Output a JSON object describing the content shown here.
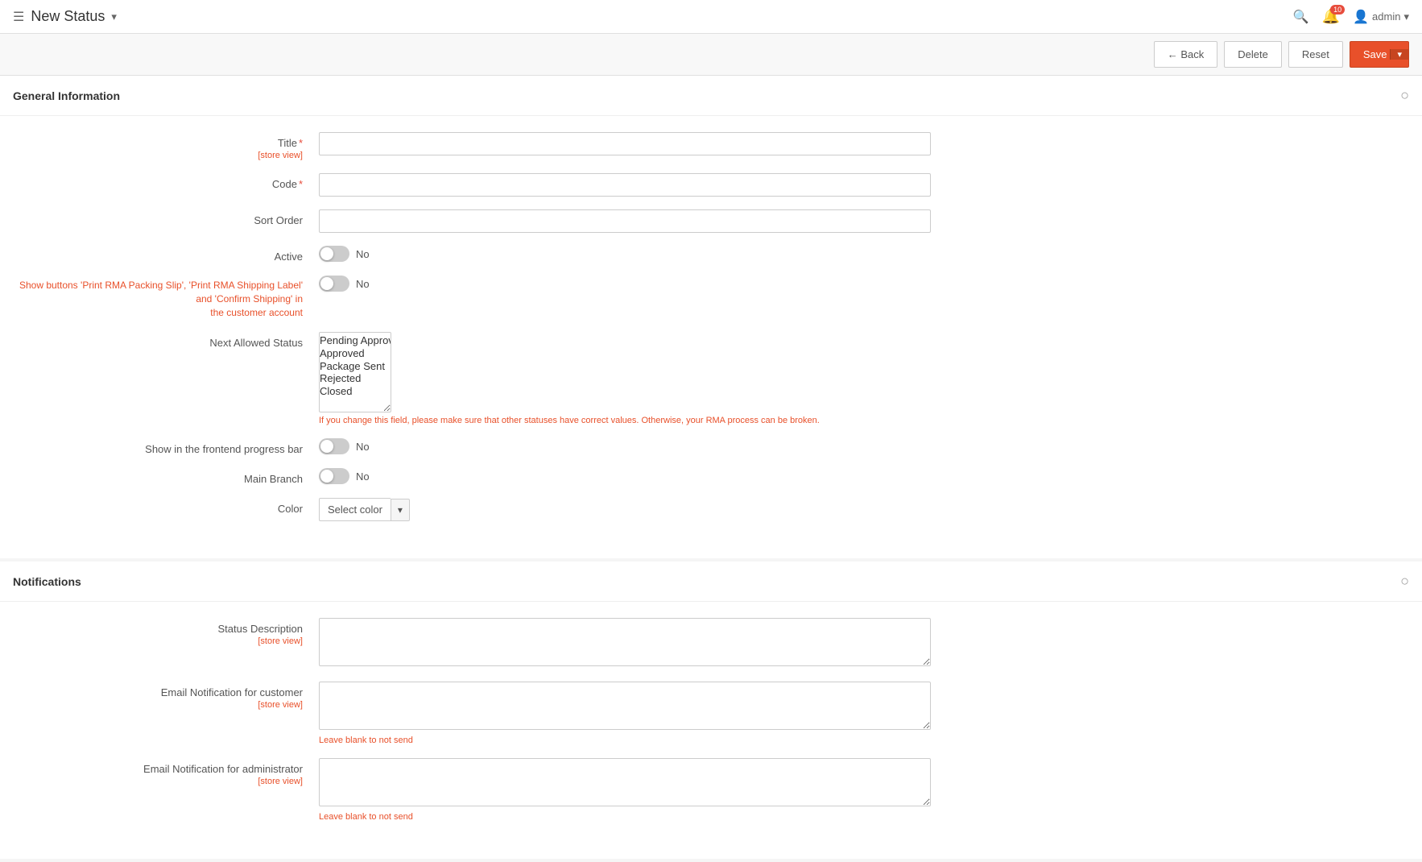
{
  "header": {
    "title": "New Status",
    "dropdown_arrow": "▾",
    "hamburger": "☰",
    "search_icon": "🔍",
    "bell_icon": "🔔",
    "notification_count": "10",
    "user_icon": "👤",
    "user_name": "admin",
    "user_arrow": "▾"
  },
  "actionbar": {
    "back_label": "← Back",
    "delete_label": "Delete",
    "reset_label": "Reset",
    "save_label": "Save",
    "save_dropdown_arrow": "▾"
  },
  "sections": {
    "general": {
      "title": "General Information",
      "toggle_icon": "○",
      "fields": {
        "title_label": "Title",
        "title_sublabel": "[store view]",
        "title_required": "*",
        "code_label": "Code",
        "code_required": "*",
        "sort_order_label": "Sort Order",
        "active_label": "Active",
        "active_toggle_text": "No",
        "buttons_label": "Show buttons 'Print RMA Packing Slip', 'Print RMA Shipping Label' and 'Confirm Shipping' in\nthe customer account",
        "buttons_toggle_text": "No",
        "next_allowed_label": "Next Allowed Status",
        "next_allowed_items": [
          "Pending Approval",
          "Approved",
          "Package Sent",
          "Rejected",
          "Closed"
        ],
        "next_allowed_hint": "If you change this field, please make sure that other statuses have correct values. Otherwise, your RMA process can be broken.",
        "frontend_progress_label": "Show in the frontend progress bar",
        "frontend_progress_toggle_text": "No",
        "main_branch_label": "Main Branch",
        "main_branch_toggle_text": "No",
        "color_label": "Color",
        "color_select_text": "Select color",
        "color_arrow": "▾"
      }
    },
    "notifications": {
      "title": "Notifications",
      "toggle_icon": "○",
      "fields": {
        "status_desc_label": "Status Description",
        "status_desc_sublabel": "[store view]",
        "email_customer_label": "Email Notification for customer",
        "email_customer_sublabel": "[store view]",
        "email_customer_hint": "Leave blank to not send",
        "email_admin_label": "Email Notification for administrator",
        "email_admin_sublabel": "[store view]",
        "email_admin_hint": "Leave blank to not send"
      }
    }
  }
}
